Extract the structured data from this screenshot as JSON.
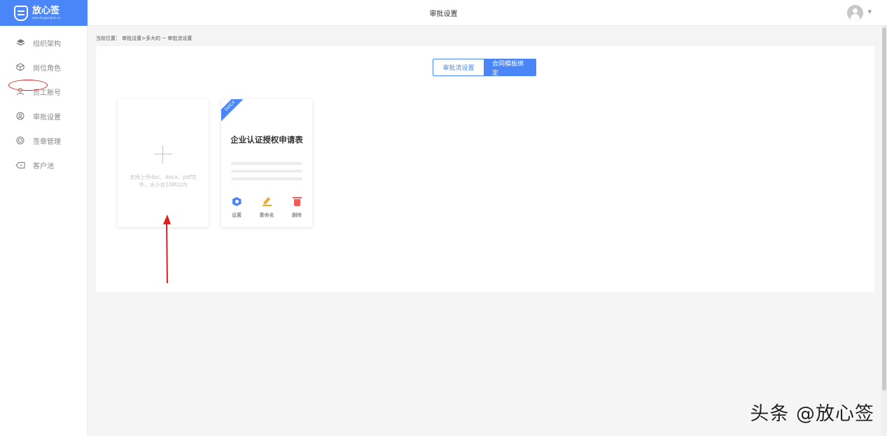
{
  "brand": {
    "name": "放心签",
    "sub": "www.fangxinqian.cn"
  },
  "header": {
    "title": "审批设置"
  },
  "sidebar": {
    "items": [
      {
        "label": "组织架构",
        "icon": "layers-icon"
      },
      {
        "label": "岗位角色",
        "icon": "cube-icon"
      },
      {
        "label": "员工账号",
        "icon": "user-icon"
      },
      {
        "label": "审批设置",
        "icon": "approval-icon"
      },
      {
        "label": "签章管理",
        "icon": "stamp-icon"
      },
      {
        "label": "客户池",
        "icon": "tag-icon"
      }
    ]
  },
  "breadcrumb": "当前位置： 审批设置>多大的 ~ 审批流设置",
  "tabs": [
    {
      "label": "审批流设置",
      "active": false
    },
    {
      "label": "合同模板绑定",
      "active": true
    }
  ],
  "upload": {
    "hint": "支持上传doc、docx、pdf文件，大小在10M以内"
  },
  "template": {
    "badge": "DOCX",
    "title": "企业认证授权申请表",
    "actions": [
      {
        "label": "设置",
        "icon": "settings-icon"
      },
      {
        "label": "重命名",
        "icon": "edit-icon"
      },
      {
        "label": "删除",
        "icon": "trash-icon"
      }
    ]
  },
  "watermark": "头条 @放心签",
  "colors": {
    "accent": "#4a86f7",
    "annotation": "#e02020"
  }
}
